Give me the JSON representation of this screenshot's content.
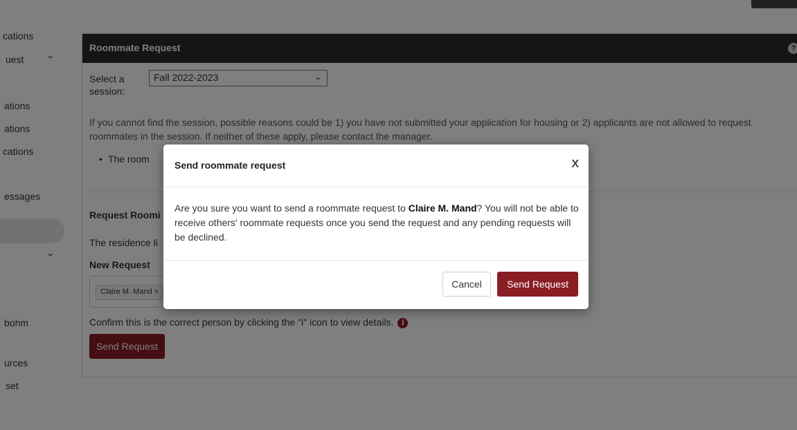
{
  "sidebar": {
    "items": [
      {
        "label": "cations"
      },
      {
        "label": "uest"
      },
      {
        "label": "ations"
      },
      {
        "label": "ations"
      },
      {
        "label": "cations"
      },
      {
        "label": "essages"
      },
      {
        "label": "bohm"
      },
      {
        "label": "urces"
      },
      {
        "label": "set"
      }
    ]
  },
  "panel": {
    "title": "Roommate Request",
    "help_icon": "?",
    "session_label": "Select a session:",
    "session_value": "Fall 2022-2023",
    "info_text": "If you cannot find the session, possible reasons could be 1) you have not submitted your application for housing or 2) applicants are not allowed to request roommates in the session. If neither of these apply, please contact the manager.",
    "bullet_text": "The room",
    "request_heading": "Request Roomi",
    "residence_text": "The residence li",
    "new_request_label": "New Request",
    "selected_person": "Claire M. Mand ×",
    "confirm_text": "Confirm this is the correct person by clicking the \"i\" icon to view details.",
    "info_icon": "i",
    "send_label": "Send Request"
  },
  "modal": {
    "title": "Send roommate request",
    "close_label": "X",
    "body_prefix": "Are you sure you want to send a roommate request to ",
    "body_name": "Claire M. Mand",
    "body_suffix": "? You will not be able to receive others' roommate requests once you send the request and any pending requests will be declined.",
    "cancel_label": "Cancel",
    "send_label": "Send Request"
  },
  "colors": {
    "accent": "#8a1c24",
    "header_bg": "#2b2b2b",
    "overlay": "rgba(0,0,0,0.5)"
  },
  "icons": {
    "chevron": "chevron-down-icon",
    "help": "help-icon",
    "info": "info-icon",
    "close": "close-icon"
  }
}
